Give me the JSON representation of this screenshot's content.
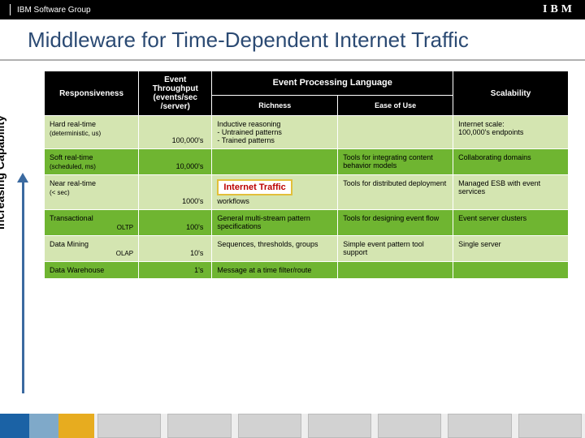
{
  "header": {
    "group": "IBM Software Group",
    "logo": "IBM"
  },
  "title": "Middleware for Time-Dependent Internet Traffic",
  "axis_label": "Increasing Capability",
  "columns": {
    "responsiveness": "Responsiveness",
    "throughput": "Event Throughput",
    "throughput_unit": "(events/sec /server)",
    "epl_group": "Event Processing Language",
    "richness": "Richness",
    "ease": "Ease of Use",
    "scalability": "Scalability"
  },
  "rows": [
    {
      "resp": "Hard real-time",
      "resp_sub": "(deterministic, us)",
      "throughput": "100,000's",
      "richness": "Inductive reasoning\n- Untrained patterns\n- Trained patterns",
      "ease": "",
      "scalability": "Internet scale:\n100,000's endpoints"
    },
    {
      "resp": "Soft real-time",
      "resp_sub": "(scheduled, ms)",
      "throughput": "10,000's",
      "richness": "",
      "ease": "Tools for   integrating content behavior models",
      "scalability": "Collaborating domains"
    },
    {
      "resp": "Near real-time",
      "resp_sub": "(< sec)",
      "throughput": "1000's",
      "badge": "Internet Traffic",
      "richness_extra": "workflows",
      "ease": "Tools for distributed deployment",
      "scalability": "Managed ESB with event services"
    },
    {
      "resp": "Transactional",
      "resp_sub": "OLTP",
      "throughput": "100's",
      "richness": "General multi-stream pattern specifications",
      "ease": "Tools for designing event flow",
      "scalability": "Event server clusters"
    },
    {
      "resp": "Data Mining",
      "resp_sub": "OLAP",
      "throughput": "10's",
      "richness": "Sequences, thresholds, groups",
      "ease": "Simple event pattern tool support",
      "scalability": "Single server"
    },
    {
      "resp": "Data Warehouse",
      "resp_sub": "",
      "throughput": "1's",
      "richness": "Message at a time filter/route",
      "ease": "",
      "scalability": ""
    }
  ]
}
